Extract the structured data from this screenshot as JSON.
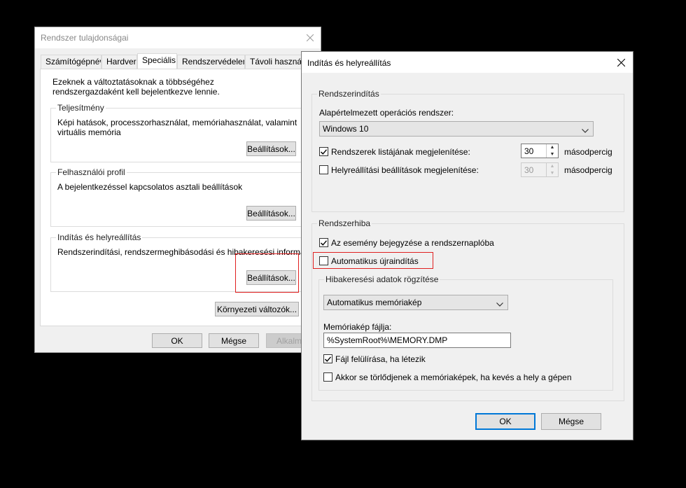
{
  "system_props": {
    "title": "Rendszer tulajdonságai",
    "tabs": [
      {
        "label": "Számítógépnév"
      },
      {
        "label": "Hardver"
      },
      {
        "label": "Speciális"
      },
      {
        "label": "Rendszervédelem"
      },
      {
        "label": "Távoli használat"
      }
    ],
    "intro": "Ezeknek a változtatásoknak a többségéhez rendszergazdaként kell bejelentkezve lennie.",
    "performance": {
      "title": "Teljesítmény",
      "desc": "Képi hatások, processzorhasználat, memóriahasználat, valamint virtuális memória",
      "button": "Beállítások..."
    },
    "user_profile": {
      "title": "Felhasználói profil",
      "desc": "A bejelentkezéssel kapcsolatos asztali beállítások",
      "button": "Beállítások..."
    },
    "startup": {
      "title": "Indítás és helyreállítás",
      "desc": "Rendszerindítási, rendszermeghibásodási és hibakeresési információk",
      "button": "Beállítások..."
    },
    "env_button": "Környezeti változók...",
    "ok": "OK",
    "cancel": "Mégse",
    "apply": "Alkalmaz"
  },
  "startup_dialog": {
    "title": "Indítás és helyreállítás",
    "system_startup": {
      "title": "Rendszerindítás",
      "default_os_label": "Alapértelmezett operációs rendszer:",
      "default_os_value": "Windows 10",
      "show_list_label": "Rendszerek listájának megjelenítése:",
      "show_list_checked": true,
      "show_list_seconds": "30",
      "show_recovery_label": "Helyreállítási beállítások megjelenítése:",
      "show_recovery_checked": false,
      "show_recovery_seconds": "30",
      "seconds_unit": "másodpercig"
    },
    "system_failure": {
      "title": "Rendszerhiba",
      "write_event_label": "Az esemény bejegyzése a rendszernaplóba",
      "write_event_checked": true,
      "auto_restart_label": "Automatikus újraindítás",
      "auto_restart_checked": false,
      "debug_info": {
        "title": "Hibakeresési adatok rögzítése",
        "dump_type": "Automatikus memóriakép",
        "dump_file_label": "Memóriakép fájlja:",
        "dump_file_value": "%SystemRoot%\\MEMORY.DMP",
        "overwrite_label": "Fájl felülírása, ha létezik",
        "overwrite_checked": true,
        "disable_autodelete_label": "Akkor se törlődjenek a memóriaképek, ha kevés a hely a gépen",
        "disable_autodelete_checked": false
      }
    },
    "ok": "OK",
    "cancel": "Mégse"
  },
  "colors": {
    "highlight": "#e02020",
    "accent": "#0078d7"
  }
}
